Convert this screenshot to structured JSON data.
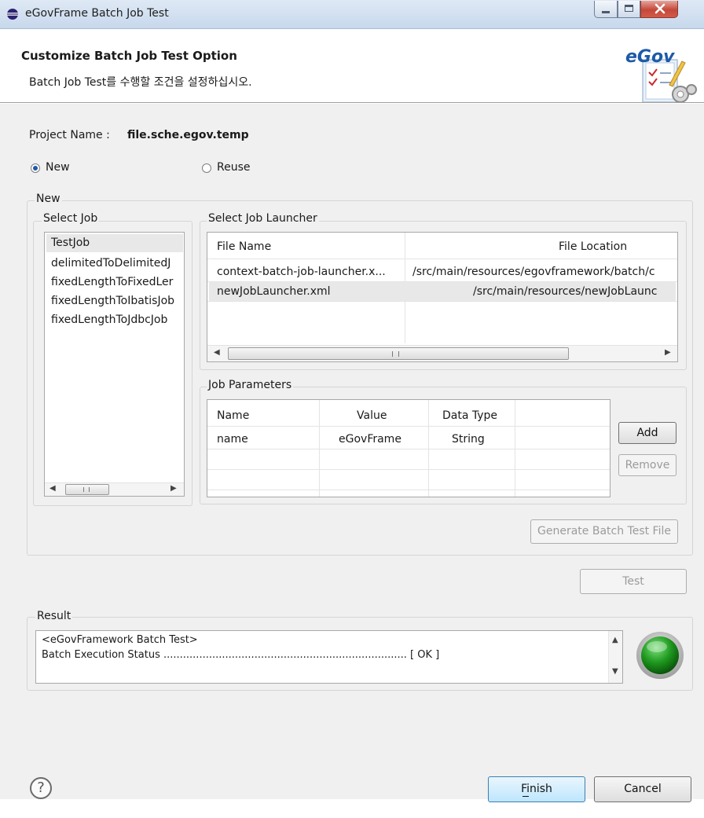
{
  "window": {
    "title": "eGovFrame Batch Job Test"
  },
  "header": {
    "title": "Customize Batch Job Test Option",
    "subtitle": "Batch Job Test를 수행할 조건을 설정하십시오.",
    "logo_text": "eGov"
  },
  "project": {
    "label": "Project Name :",
    "value": "file.sche.egov.temp"
  },
  "mode": {
    "new_label": "New",
    "reuse_label": "Reuse",
    "selected": "New"
  },
  "new_group": {
    "label": "New"
  },
  "select_job": {
    "label": "Select Job",
    "items": [
      "TestJob",
      "delimitedToDelimitedJ",
      "fixedLengthToFixedLer",
      "fixedLengthToIbatisJob",
      "fixedLengthToJdbcJob"
    ],
    "selected_index": 0
  },
  "select_launcher": {
    "label": "Select Job Launcher",
    "columns": [
      "File Name",
      "File Location"
    ],
    "rows": [
      [
        "context-batch-job-launcher.x...",
        "/src/main/resources/egovframework/batch/c"
      ],
      [
        "newJobLauncher.xml",
        "/src/main/resources/newJobLaunc"
      ]
    ],
    "selected_index": 1
  },
  "job_parameters": {
    "label": "Job Parameters",
    "columns": [
      "Name",
      "Value",
      "Data Type"
    ],
    "rows": [
      [
        "name",
        "eGovFrame",
        "String"
      ]
    ],
    "add_label": "Add",
    "remove_label": "Remove"
  },
  "generate_label": "Generate Batch Test File",
  "test_label": "Test",
  "result": {
    "label": "Result",
    "lines": [
      "<eGovFramework Batch Test>",
      "Batch Execution Status ........................................................................... [ OK ]"
    ],
    "status_color": "#2e9e2e"
  },
  "footer": {
    "help_symbol": "?",
    "finish_label": "Finish",
    "cancel_label": "Cancel"
  },
  "colors": {
    "accent": "#3c7fb1",
    "selection": "#e8e8e8",
    "title_gradient_top": "#dfe9f5"
  }
}
